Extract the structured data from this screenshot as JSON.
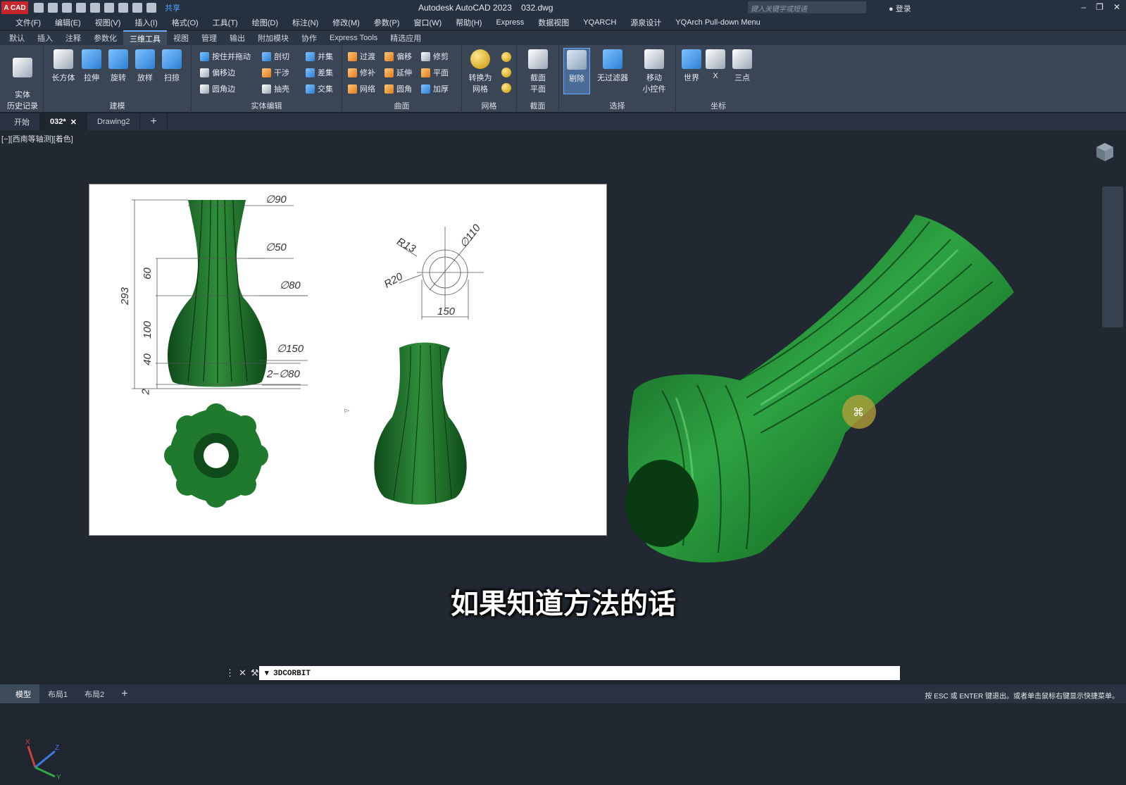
{
  "titlebar": {
    "logo": "A CAD",
    "share_label": "共享",
    "app_title": "Autodesk AutoCAD 2023",
    "file_name": "032.dwg",
    "search_placeholder": "键入关键字或短语",
    "login_label": "登录"
  },
  "menubar": [
    "文件(F)",
    "编辑(E)",
    "视图(V)",
    "插入(I)",
    "格式(O)",
    "工具(T)",
    "绘图(D)",
    "标注(N)",
    "修改(M)",
    "参数(P)",
    "窗口(W)",
    "帮助(H)",
    "Express",
    "数据视图",
    "YQARCH",
    "源泉设计",
    "YQArch Pull-down Menu"
  ],
  "ribbon_tabs": [
    "默认",
    "插入",
    "注释",
    "参数化",
    "三维工具",
    "视图",
    "管理",
    "输出",
    "附加模块",
    "协作",
    "Express Tools",
    "精选应用"
  ],
  "active_ribbon_tab": "三维工具",
  "ribbon": {
    "history": "实体\n历史记录",
    "modeling": {
      "title": "建模",
      "buttons": [
        "长方体",
        "拉伸",
        "旋转",
        "放样",
        "扫掠"
      ]
    },
    "solid_edit": {
      "title": "实体编辑",
      "buttons": [
        "按住并拖动",
        "剖切",
        "并集",
        "偏移边",
        "干涉",
        "差集",
        "圆角边",
        "抽壳",
        "交集"
      ]
    },
    "surface": {
      "title": "曲面",
      "buttons": [
        "过渡",
        "偏移",
        "修剪",
        "修补",
        "延伸",
        "平面",
        "网络",
        "圆角",
        "加厚"
      ]
    },
    "mesh": {
      "title": "网格",
      "buttons": [
        "转换为\n网格"
      ]
    },
    "section": {
      "title": "截面",
      "buttons": [
        "截面\n平面"
      ]
    },
    "selection": {
      "title": "选择",
      "buttons": [
        "剔除",
        "无过滤器",
        "移动\n小控件"
      ]
    },
    "coordinates": {
      "title": "坐标",
      "buttons": [
        "世界",
        "X",
        "三点"
      ]
    }
  },
  "doc_tabs": [
    "开始",
    "032*",
    "Drawing2"
  ],
  "active_doc_tab": "032*",
  "viewport_label": "[−][西南等轴测][着色]",
  "drawing_dims": {
    "d90": "∅90",
    "d50": "∅50",
    "d80": "∅80",
    "d150": "∅150",
    "d2_80": "2−∅80",
    "h293": "293",
    "h60": "60",
    "h100": "100",
    "h40": "40",
    "h2": "2",
    "r13": "R13",
    "r20": "R20",
    "d110": "∅110",
    "w150": "150"
  },
  "subtitle": "如果知道方法的话",
  "command": "3DCORBIT",
  "layout_tabs": [
    "模型",
    "布局1",
    "布局2"
  ],
  "active_layout_tab": "模型",
  "status_message": "按 ESC 或 ENTER 键退出。或者单击鼠标右键显示快捷菜单。",
  "colors": {
    "vase_green": "#1f7a2e",
    "accent": "#6aa9ff"
  }
}
